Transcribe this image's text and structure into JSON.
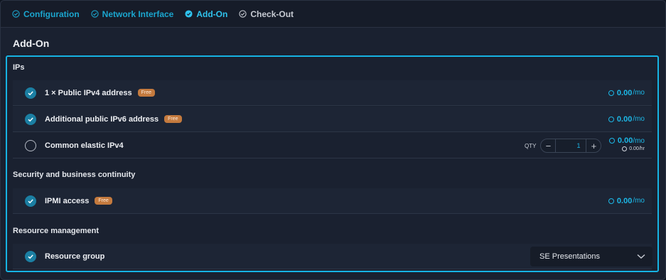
{
  "stepper": {
    "steps": [
      {
        "label": "Configuration",
        "state": "done"
      },
      {
        "label": "Network Interface",
        "state": "done"
      },
      {
        "label": "Add-On",
        "state": "active"
      },
      {
        "label": "Check-Out",
        "state": "pending"
      }
    ]
  },
  "section": {
    "title": "Add-On"
  },
  "groups": {
    "ips": {
      "label": "IPs",
      "rows": [
        {
          "label": "1 × Public IPv4 address",
          "badge": "Free",
          "checked": true,
          "price": "0.00",
          "unit": "/mo"
        },
        {
          "label": "Additional public IPv6 address",
          "badge": "Free",
          "checked": true,
          "price": "0.00",
          "unit": "/mo"
        },
        {
          "label": "Common elastic IPv4",
          "checked": false,
          "qty_label": "QTY",
          "qty_minus": "−",
          "qty_value": "1",
          "qty_plus": "+",
          "price": "0.00",
          "unit": "/mo",
          "hourly_price": "0.00/hr"
        }
      ]
    },
    "security": {
      "label": "Security and business continuity",
      "rows": [
        {
          "label": "IPMI access",
          "badge": "Free",
          "checked": true,
          "price": "0.00",
          "unit": "/mo"
        }
      ]
    },
    "resource": {
      "label": "Resource management",
      "rows": [
        {
          "label": "Resource group",
          "checked": true,
          "select_value": "SE Presentations"
        }
      ]
    }
  },
  "colors": {
    "accent": "#16b3e3",
    "badge": "#c47a3e",
    "check": "#1b7fa3"
  }
}
